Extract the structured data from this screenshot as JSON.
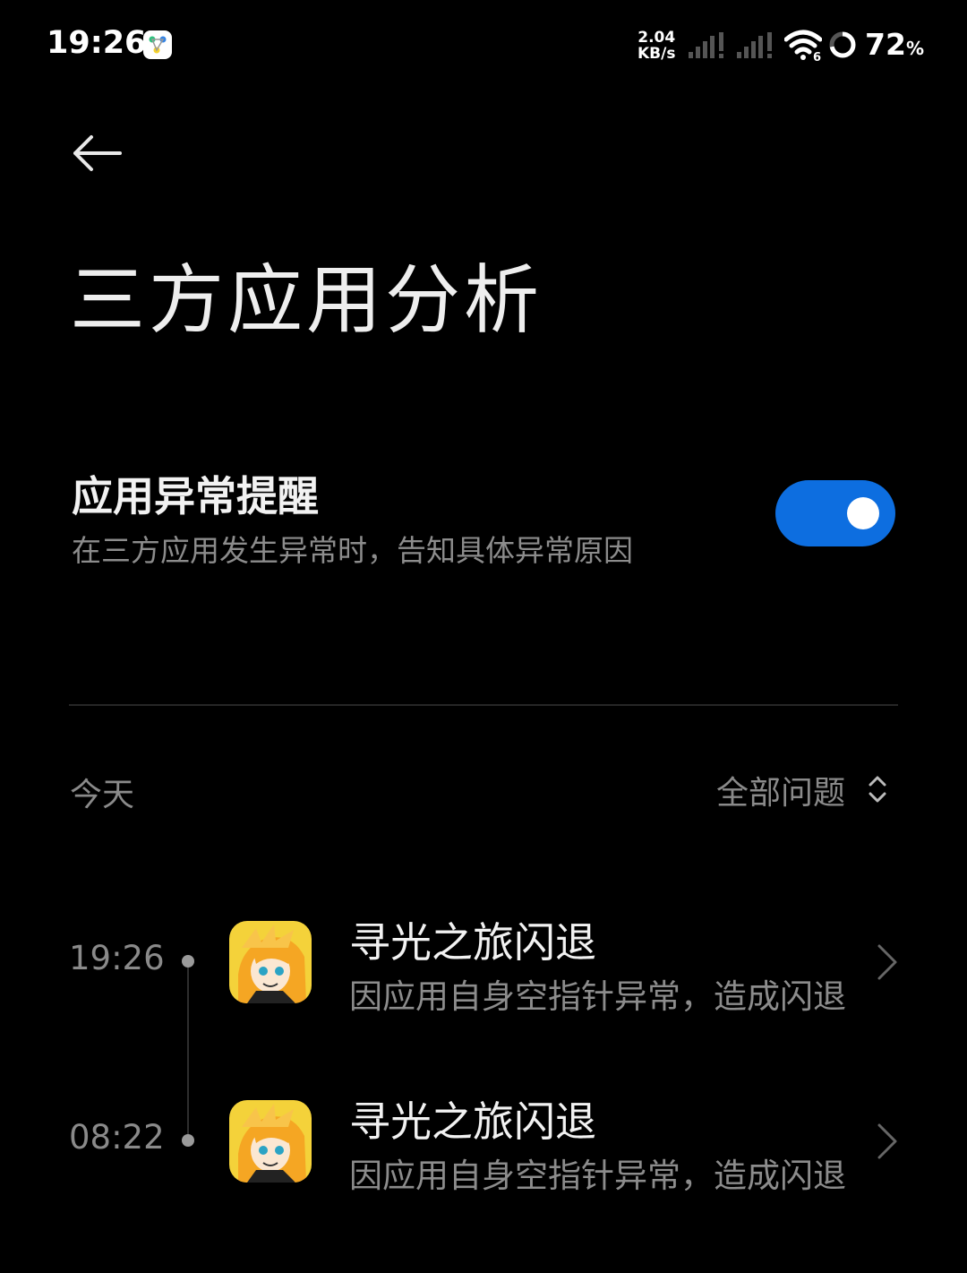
{
  "status_bar": {
    "time": "19:26",
    "net_speed_value": "2.04",
    "net_speed_unit": "KB/s",
    "battery_value": "72",
    "battery_unit": "%",
    "wifi_badge": "6"
  },
  "header": {
    "title": "三方应用分析"
  },
  "setting": {
    "title": "应用异常提醒",
    "description": "在三方应用发生异常时，告知具体异常原因",
    "enabled": true,
    "accent_color": "#0d6ee0"
  },
  "list": {
    "section_label": "今天",
    "filter_label": "全部问题",
    "entries": [
      {
        "time": "19:26",
        "title": "寻光之旅闪退",
        "description": "因应用自身空指针异常，造成闪退",
        "icon": "game-app-icon"
      },
      {
        "time": "08:22",
        "title": "寻光之旅闪退",
        "description": "因应用自身空指针异常，造成闪退",
        "icon": "game-app-icon"
      }
    ]
  }
}
